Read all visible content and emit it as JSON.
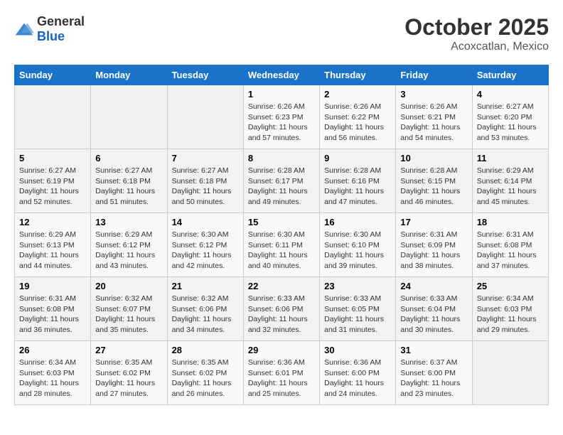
{
  "header": {
    "logo_general": "General",
    "logo_blue": "Blue",
    "title": "October 2025",
    "subtitle": "Acoxcatlan, Mexico"
  },
  "weekdays": [
    "Sunday",
    "Monday",
    "Tuesday",
    "Wednesday",
    "Thursday",
    "Friday",
    "Saturday"
  ],
  "weeks": [
    [
      {
        "day": "",
        "empty": true
      },
      {
        "day": "",
        "empty": true
      },
      {
        "day": "",
        "empty": true
      },
      {
        "day": "1",
        "sunrise": "6:26 AM",
        "sunset": "6:23 PM",
        "daylight": "11 hours and 57 minutes."
      },
      {
        "day": "2",
        "sunrise": "6:26 AM",
        "sunset": "6:22 PM",
        "daylight": "11 hours and 56 minutes."
      },
      {
        "day": "3",
        "sunrise": "6:26 AM",
        "sunset": "6:21 PM",
        "daylight": "11 hours and 54 minutes."
      },
      {
        "day": "4",
        "sunrise": "6:27 AM",
        "sunset": "6:20 PM",
        "daylight": "11 hours and 53 minutes."
      }
    ],
    [
      {
        "day": "5",
        "sunrise": "6:27 AM",
        "sunset": "6:19 PM",
        "daylight": "11 hours and 52 minutes."
      },
      {
        "day": "6",
        "sunrise": "6:27 AM",
        "sunset": "6:18 PM",
        "daylight": "11 hours and 51 minutes."
      },
      {
        "day": "7",
        "sunrise": "6:27 AM",
        "sunset": "6:18 PM",
        "daylight": "11 hours and 50 minutes."
      },
      {
        "day": "8",
        "sunrise": "6:28 AM",
        "sunset": "6:17 PM",
        "daylight": "11 hours and 49 minutes."
      },
      {
        "day": "9",
        "sunrise": "6:28 AM",
        "sunset": "6:16 PM",
        "daylight": "11 hours and 47 minutes."
      },
      {
        "day": "10",
        "sunrise": "6:28 AM",
        "sunset": "6:15 PM",
        "daylight": "11 hours and 46 minutes."
      },
      {
        "day": "11",
        "sunrise": "6:29 AM",
        "sunset": "6:14 PM",
        "daylight": "11 hours and 45 minutes."
      }
    ],
    [
      {
        "day": "12",
        "sunrise": "6:29 AM",
        "sunset": "6:13 PM",
        "daylight": "11 hours and 44 minutes."
      },
      {
        "day": "13",
        "sunrise": "6:29 AM",
        "sunset": "6:12 PM",
        "daylight": "11 hours and 43 minutes."
      },
      {
        "day": "14",
        "sunrise": "6:30 AM",
        "sunset": "6:12 PM",
        "daylight": "11 hours and 42 minutes."
      },
      {
        "day": "15",
        "sunrise": "6:30 AM",
        "sunset": "6:11 PM",
        "daylight": "11 hours and 40 minutes."
      },
      {
        "day": "16",
        "sunrise": "6:30 AM",
        "sunset": "6:10 PM",
        "daylight": "11 hours and 39 minutes."
      },
      {
        "day": "17",
        "sunrise": "6:31 AM",
        "sunset": "6:09 PM",
        "daylight": "11 hours and 38 minutes."
      },
      {
        "day": "18",
        "sunrise": "6:31 AM",
        "sunset": "6:08 PM",
        "daylight": "11 hours and 37 minutes."
      }
    ],
    [
      {
        "day": "19",
        "sunrise": "6:31 AM",
        "sunset": "6:08 PM",
        "daylight": "11 hours and 36 minutes."
      },
      {
        "day": "20",
        "sunrise": "6:32 AM",
        "sunset": "6:07 PM",
        "daylight": "11 hours and 35 minutes."
      },
      {
        "day": "21",
        "sunrise": "6:32 AM",
        "sunset": "6:06 PM",
        "daylight": "11 hours and 34 minutes."
      },
      {
        "day": "22",
        "sunrise": "6:33 AM",
        "sunset": "6:06 PM",
        "daylight": "11 hours and 32 minutes."
      },
      {
        "day": "23",
        "sunrise": "6:33 AM",
        "sunset": "6:05 PM",
        "daylight": "11 hours and 31 minutes."
      },
      {
        "day": "24",
        "sunrise": "6:33 AM",
        "sunset": "6:04 PM",
        "daylight": "11 hours and 30 minutes."
      },
      {
        "day": "25",
        "sunrise": "6:34 AM",
        "sunset": "6:03 PM",
        "daylight": "11 hours and 29 minutes."
      }
    ],
    [
      {
        "day": "26",
        "sunrise": "6:34 AM",
        "sunset": "6:03 PM",
        "daylight": "11 hours and 28 minutes."
      },
      {
        "day": "27",
        "sunrise": "6:35 AM",
        "sunset": "6:02 PM",
        "daylight": "11 hours and 27 minutes."
      },
      {
        "day": "28",
        "sunrise": "6:35 AM",
        "sunset": "6:02 PM",
        "daylight": "11 hours and 26 minutes."
      },
      {
        "day": "29",
        "sunrise": "6:36 AM",
        "sunset": "6:01 PM",
        "daylight": "11 hours and 25 minutes."
      },
      {
        "day": "30",
        "sunrise": "6:36 AM",
        "sunset": "6:00 PM",
        "daylight": "11 hours and 24 minutes."
      },
      {
        "day": "31",
        "sunrise": "6:37 AM",
        "sunset": "6:00 PM",
        "daylight": "11 hours and 23 minutes."
      },
      {
        "day": "",
        "empty": true
      }
    ]
  ],
  "labels": {
    "sunrise_prefix": "Sunrise: ",
    "sunset_prefix": "Sunset: ",
    "daylight_prefix": "Daylight: "
  }
}
